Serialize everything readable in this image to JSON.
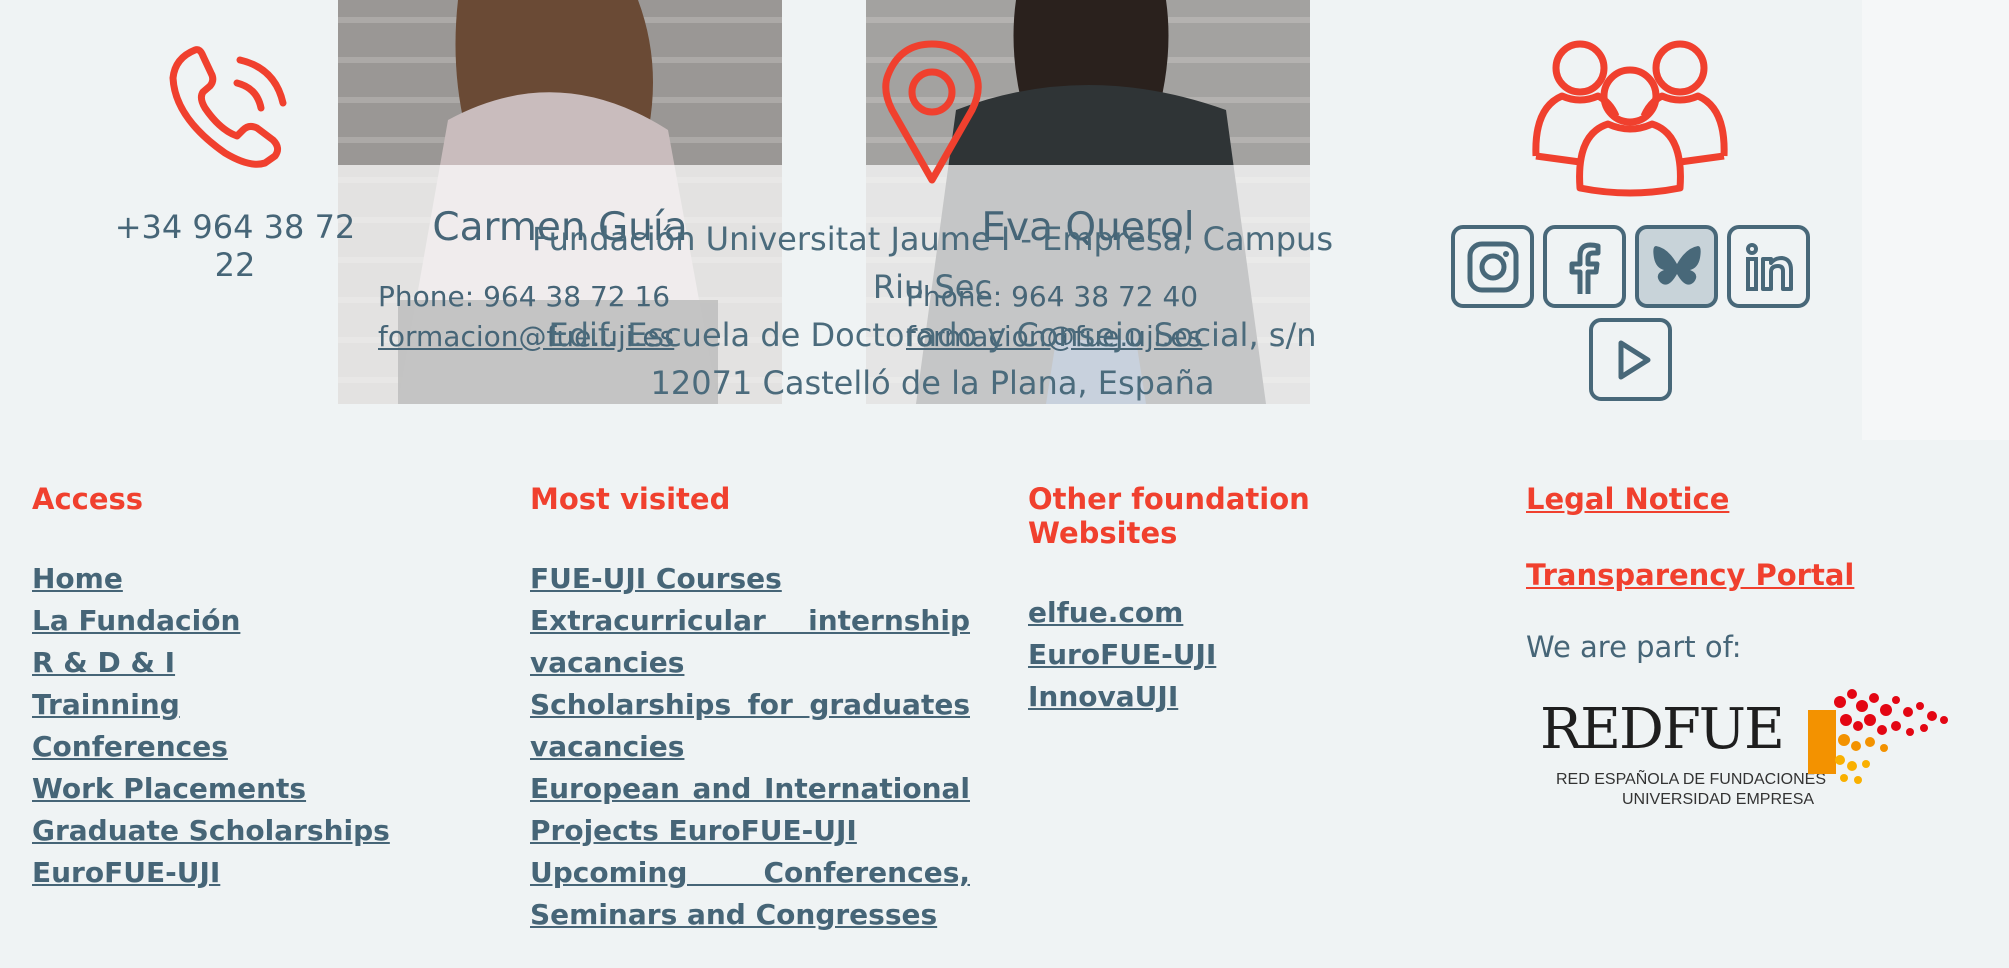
{
  "colors": {
    "accent": "#f0402e",
    "text": "#466577",
    "background": "#eff3f4"
  },
  "contact": {
    "phone_number": "+34 964 38 72 22",
    "address_lines": [
      "Fundación Universitat Jaume I - Empresa, Campus Riu Sec",
      "Edif. Escuela de Doctorado y Consejo Social, s/n",
      "12071 Castelló de la Plana, España"
    ],
    "icons": [
      "phone-icon",
      "location-pin-icon",
      "people-icon"
    ]
  },
  "cards": [
    {
      "name": "Carmen Guía",
      "phone": "Phone: 964 38 72 16",
      "email": "formacion@fue.uji.es"
    },
    {
      "name": "Eva Querol",
      "phone": "Phone: 964 38 72 40",
      "email": "formacion@fue.uji.es"
    }
  ],
  "socials": [
    {
      "icon": "instagram-icon"
    },
    {
      "icon": "facebook-icon"
    },
    {
      "icon": "bluesky-icon"
    },
    {
      "icon": "linkedin-icon"
    },
    {
      "icon": "youtube-icon"
    }
  ],
  "footer": {
    "access": {
      "title": "Access",
      "links": [
        "Home",
        "La Fundación",
        "R & D & I",
        "Trainning",
        "Conferences",
        "Work Placements",
        "Graduate Scholarships",
        "EuroFUE-UJI"
      ]
    },
    "most_visited": {
      "title": "Most visited",
      "links": [
        "FUE-UJI Courses",
        "Extracurricular internship vacancies",
        "Scholarships for graduates vacancies",
        "European and International Projects EuroFUE-UJI",
        "Upcoming Conferences, Seminars and Congresses"
      ]
    },
    "other_sites": {
      "title": "Other foundation Websites",
      "links": [
        "elfue.com",
        "EuroFUE-UJI",
        "InnovaUJI"
      ]
    },
    "legal": {
      "legal_notice": "Legal Notice",
      "transparency": "Transparency Portal",
      "part_of": "We are part of:",
      "logo_text": "REDFUE",
      "logo_subtitle_1": "RED ESPAÑOLA DE FUNDACIONES",
      "logo_subtitle_2": "UNIVERSIDAD EMPRESA"
    }
  }
}
